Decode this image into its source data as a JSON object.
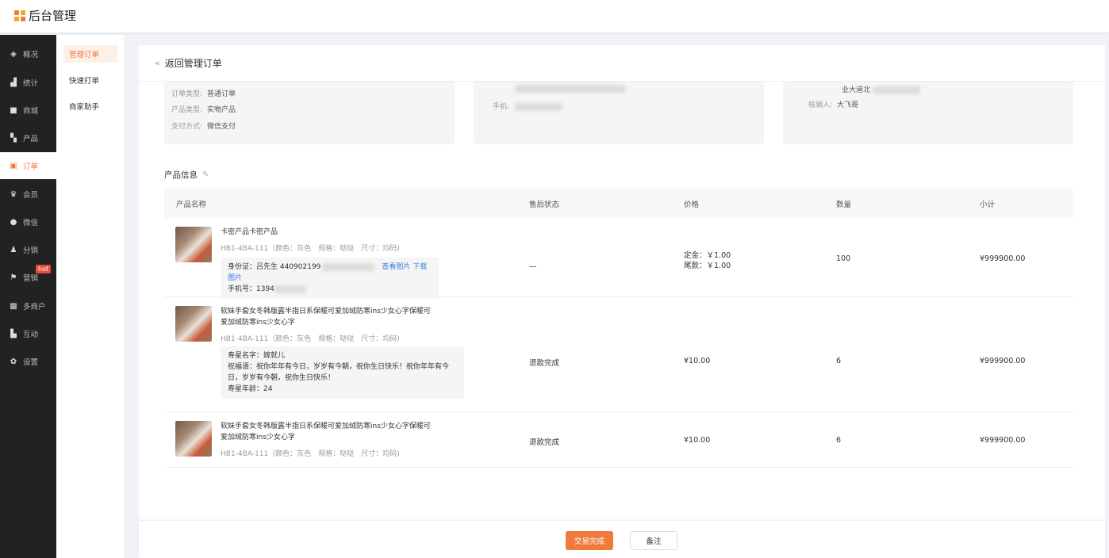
{
  "app": {
    "title": "后台管理"
  },
  "nav": {
    "items": [
      {
        "label": "概况",
        "icon": "dashboard-icon"
      },
      {
        "label": "统计",
        "icon": "chart-icon"
      },
      {
        "label": "商城",
        "icon": "shop-icon"
      },
      {
        "label": "产品",
        "icon": "grid-icon"
      },
      {
        "label": "订单",
        "icon": "order-icon"
      },
      {
        "label": "会员",
        "icon": "crown-icon"
      },
      {
        "label": "微信",
        "icon": "wechat-icon"
      },
      {
        "label": "分销",
        "icon": "user-share-icon"
      },
      {
        "label": "营销",
        "icon": "flag-icon",
        "badge": "hot"
      },
      {
        "label": "多商户",
        "icon": "merchant-icon"
      },
      {
        "label": "互动",
        "icon": "interact-icon"
      },
      {
        "label": "设置",
        "icon": "gear-icon"
      }
    ]
  },
  "subnav": {
    "items": [
      "管理订单",
      "快速打单",
      "商家助手"
    ]
  },
  "main": {
    "back_label": "返回管理订单",
    "order_box": {
      "type_label": "订单类型:",
      "type_value": "普通订单",
      "product_type_label": "产品类型:",
      "product_type_value": "实物产品",
      "pay_label": "支付方式:",
      "pay_value": "微信支付"
    },
    "buyer_box": {
      "phone_label": "手机:"
    },
    "store_box": {
      "address_partial": "业大道北",
      "verifier_label": "核销人:",
      "verifier_value": "大飞哥"
    },
    "section_title": "产品信息",
    "columns": [
      "产品名称",
      "售后状态",
      "价格",
      "数量",
      "小计"
    ],
    "rows": [
      {
        "name": "卡密产品卡密产品",
        "sku": "HB1-4BA-111（颜色：灰色　规格：哒哒　尺寸：均码)",
        "extra_id_label": "身份证：吕先生  440902199",
        "extra_link_view": "查看图片",
        "extra_link_download": "下载图片",
        "extra_phone": "手机号：1394",
        "status": "—",
        "price_deposit": "定金：￥1.00",
        "price_balance": "尾款：￥1.00",
        "qty": "100",
        "subtotal": "¥999900.00"
      },
      {
        "name": "软妹手套女冬韩版露半指日系保暖可爱加绒防寒ins少女心字保暖可爱加绒防寒ins少女心字",
        "sku": "HB1-4BA-111（颜色：灰色　规格：哒哒　尺寸：均码)",
        "extra_star": "寿星名字：嫁就儿",
        "extra_wish": "祝福语：祝你年年有今日，岁岁有今朝，祝你生日快乐！祝你年年有今日，岁岁有今朝，祝你生日快乐！",
        "extra_age": "寿星年龄：24",
        "status": "退款完成",
        "price": "¥10.00",
        "qty": "6",
        "subtotal": "¥999900.00"
      },
      {
        "name": "软妹手套女冬韩版露半指日系保暖可爱加绒防寒ins少女心字保暖可爱加绒防寒ins少女心字",
        "sku": "HB1-4BA-111（颜色：灰色　规格：哒哒　尺寸：均码)",
        "status": "退款完成",
        "price": "¥10.00",
        "qty": "6",
        "subtotal": "¥999900.00"
      }
    ]
  },
  "footer": {
    "primary_label": "交易完成",
    "secondary_label": "备注"
  },
  "colors": {
    "accent": "#f07a3c",
    "sidebar": "#222222",
    "link": "#3b7ddd",
    "hot": "#e74c3c"
  }
}
